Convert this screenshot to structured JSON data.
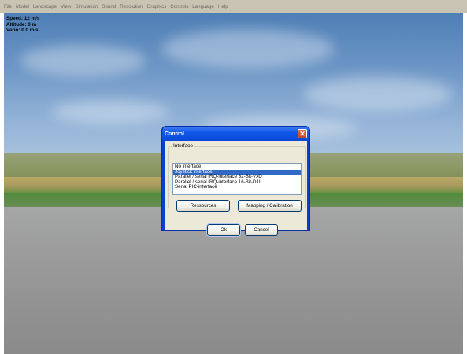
{
  "menubar": {
    "items": [
      "File",
      "Model",
      "Landscape",
      "View",
      "Simulation",
      "Sound",
      "Resolution",
      "Graphics",
      "Controls",
      "Language",
      "Help"
    ]
  },
  "hud": {
    "speed": "Speed: 12 m/s",
    "altitude": "Altitude: 0 m",
    "vario": "Vario: 0.0 m/s"
  },
  "dialog": {
    "title": "Control",
    "close_glyph": "✕",
    "group_label": "Interface",
    "options": [
      "No interface",
      "Joystick interface",
      "Parallel / serial IRQ-interface 32-Bit-VxD",
      "Parallel / serial IRQ-interface 16-Bit-DLL",
      "Serial PIC-interface"
    ],
    "selected_option": "Joystick interface",
    "buttons": {
      "resources": "Ressources",
      "mapping": "Mapping / Calibration",
      "ok": "Ok",
      "cancel": "Cancel"
    }
  },
  "colors": {
    "title_bar": "#0a48d8",
    "selection": "#316ac5",
    "dialog_face": "#ece9d8"
  }
}
